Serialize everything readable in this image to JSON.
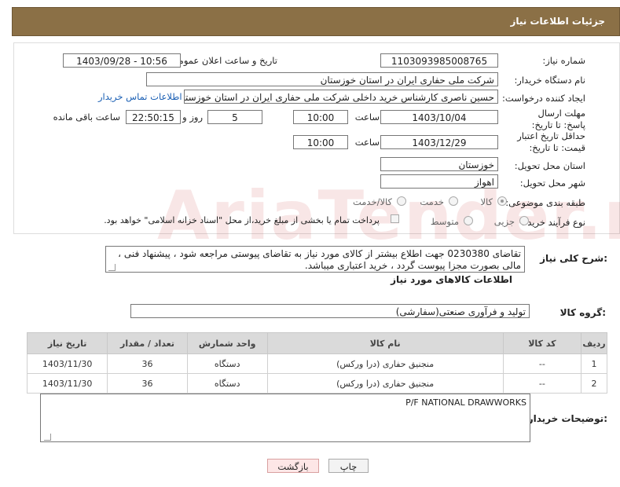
{
  "header": {
    "title": "جزئیات اطلاعات نیاز"
  },
  "form": {
    "need_number_label": "شماره نیاز:",
    "need_number": "1103093985008765",
    "announce_label": "تاریخ و ساعت اعلان عمومی:",
    "announce_value": "1403/09/28 - 10:56",
    "buyer_org_label": "نام دستگاه خریدار:",
    "buyer_org": "شرکت ملی حفاری ایران در استان خوزستان",
    "creator_label": "ایجاد کننده درخواست:",
    "creator": "حسین ناصری کارشناس خرید داخلی شرکت ملی حفاری ایران در استان خوزستان",
    "contact_link": "اطلاعات تماس خریدار",
    "deadline_label": "مهلت ارسال پاسخ: تا تاریخ:",
    "deadline_date": "1403/10/04",
    "time_label": "ساعت",
    "deadline_time": "10:00",
    "days_value": "5",
    "days_label": "روز و",
    "remaining_time": "22:50:15",
    "remaining_label": "ساعت باقی مانده",
    "validity_label": "حداقل تاریخ اعتبار قیمت: تا تاریخ:",
    "validity_date": "1403/12/29",
    "validity_time": "10:00",
    "province_label": "استان محل تحویل:",
    "province": "خوزستان",
    "city_label": "شهر محل تحویل:",
    "city": "اهواز",
    "category_label": "طبقه بندی موضوعی:",
    "category_options": [
      "کالا",
      "خدمت",
      "کالا/خدمت"
    ],
    "process_label": "نوع فرآیند خرید :",
    "process_options": [
      "جزیی",
      "متوسط"
    ],
    "payment_note": "پرداخت تمام یا بخشی از مبلغ خرید،از محل \"اسناد خزانه اسلامی\" خواهد بود."
  },
  "description": {
    "label": "شرح کلی نیاز:",
    "text": "تقاضای 0230380 جهت اطلاع بیشتر از کالای مورد نیاز به تقاضای پیوستی مراجعه شود ، پیشنهاد فنی ، مالی بصورت مجزا پیوست گردد ، خرید اعتباری میباشد."
  },
  "goods": {
    "section_title": "اطلاعات کالاهای مورد نیاز",
    "group_label": "گروه کالا:",
    "group_value": "تولید و فرآوری صنعتی(سفارشی)",
    "columns": [
      "ردیف",
      "کد کالا",
      "نام کالا",
      "واحد شمارش",
      "تعداد / مقدار",
      "تاریخ نیاز"
    ],
    "rows": [
      [
        "1",
        "--",
        "منجنیق حفاری (درا ورکس)",
        "دستگاه",
        "36",
        "1403/11/30"
      ],
      [
        "2",
        "--",
        "منجنیق حفاری (درا ورکس)",
        "دستگاه",
        "36",
        "1403/11/30"
      ]
    ]
  },
  "buyer_notes": {
    "label": "توضیحات خریدار:",
    "text": "P/F NATIONAL DRAWWORKS"
  },
  "buttons": {
    "print": "چاپ",
    "back": "بازگشت"
  },
  "watermark": "AriaTender.neT"
}
